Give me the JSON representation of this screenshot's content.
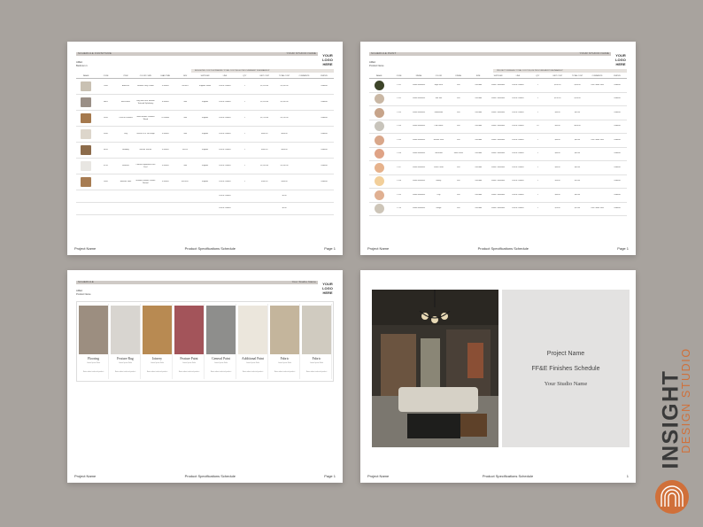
{
  "logo_text": [
    "YOUR",
    "LOGO",
    "HERE"
  ],
  "footer": {
    "project": "Project Name",
    "doc": "Product Specifications Schedule",
    "page": "Page 1",
    "page_short": "1"
  },
  "page1": {
    "header_left": "SCHEDULE   FURNITURE",
    "header_right": "YOUR STUDIO NAME",
    "area": "AREA",
    "area_name": "Bedroom 1",
    "summary": "BUDGETED COST  ESTIMATED TOTAL COST      $0.00     PROCUREMENT FEE/MARKUP",
    "columns": [
      "IMAGE",
      "CODE",
      "ITEM",
      "COLOR / SIZE",
      "LEAD TIME",
      "SKU",
      "SUPPLIER",
      "LINK",
      "QTY",
      "UNIT COST",
      "TOTAL COST",
      "COMMENTS",
      "STATUS"
    ],
    "rows": [
      [
        "",
        "CH01",
        "Armchair",
        "Weather Grey Colour",
        "4 Weeks",
        "SKU001",
        "Supplier Name",
        "Link to Product",
        "1",
        "$1,200.00",
        "$1,200.00",
        "",
        "Ordered"
      ],
      [
        "",
        "BE01",
        "Bed Frame",
        "Ivory with Rich Smooth Textured Upholstery",
        "8 Weeks",
        "N/A",
        "Supplier",
        "Link to Product",
        "1",
        "$2,200.00",
        "$2,200.00",
        "",
        "Ordered"
      ],
      [
        "",
        "DR01",
        "Chest of Drawers",
        "Solid Smooth Textured Wood",
        "10 Weeks",
        "N/A",
        "Supplier",
        "Link to Product",
        "1",
        "$1,700.00",
        "$1,700.00",
        "",
        "Ordered"
      ],
      [
        "",
        "RG01",
        "Rug",
        "Texture 90 x 180 Beige",
        "4 Weeks",
        "N/A",
        "Supplier",
        "Link to Product",
        "1",
        "$680.00",
        "$680.00",
        "",
        "Ordered"
      ],
      [
        "",
        "BD01",
        "Bedding",
        "Natural Texture",
        "4 Weeks",
        "SKU01",
        "Supplier",
        "Link to Product",
        "1",
        "$460.00",
        "$460.00",
        "",
        "Ordered"
      ],
      [
        "",
        "MT01",
        "Mattress",
        "Comfort Supportive Firm Feel",
        "4 Weeks",
        "N/A",
        "Supplier",
        "Link to Product",
        "1",
        "$1,180.00",
        "$1,180.00",
        "",
        "Ordered"
      ],
      [
        "",
        "NS01",
        "Bedside Table",
        "Wooden Smooth Texture Natural",
        "4 Weeks",
        "SKU0017",
        "Supplier",
        "Link to Product",
        "1",
        "$380.00",
        "$380.00",
        "",
        "Ordered"
      ]
    ],
    "extra_rows": [
      [
        "",
        "",
        "",
        "",
        "",
        "",
        "",
        "Link to Product",
        "",
        "",
        "$0.00",
        "",
        ""
      ],
      [
        "",
        "",
        "",
        "",
        "",
        "",
        "",
        "Link to Product",
        "",
        "",
        "$0.00",
        "",
        ""
      ]
    ],
    "thumb_colors": [
      "#c9c1b3",
      "#9a8f86",
      "#a5794d",
      "#ddd6cb",
      "#8c6b4a",
      "#e8e6e2",
      "#a77c52"
    ]
  },
  "page2": {
    "header_left": "SCHEDULE   PAINT",
    "header_right": "YOUR STUDIO NAME",
    "area": "AREA",
    "area_name": "Product Name",
    "summary": "PROJECT FINISHES TOTAL COST      $1,610      PROCUREMENT FEE/MARKUP",
    "columns": [
      "IMAGE",
      "CODE",
      "FINISH",
      "COLOR",
      "FINISH",
      "SIZE",
      "SUPPLIER",
      "LINK",
      "QTY",
      "UNIT COST",
      "TOTAL COST",
      "COMMENTS",
      "STATUS"
    ],
    "rows": [
      [
        "",
        "PT01",
        "Dulux Weathers",
        "Night Fern",
        "Flat",
        "1000MA",
        "Dulux / Weathers",
        "Link to Product",
        "1",
        "$100.00",
        "$100.00",
        "Two Colour Wall",
        "Ordered"
      ],
      [
        "",
        "PT02",
        "Dulux Weathers",
        "Sea Salt",
        "Flat",
        "1000MA",
        "Dulux / Weathers",
        "Link to Product",
        "1",
        "$150.00",
        "$150.00",
        "",
        "Ordered"
      ],
      [
        "",
        "PT03",
        "Dulux Weathers",
        "Sandstorm",
        "Flat",
        "1000MA",
        "Dulux / Weathers",
        "Link to Product",
        "1",
        "$80.00",
        "$80.00",
        "",
        "Ordered"
      ],
      [
        "",
        "PT04",
        "Dulux Weathers",
        "Cool Stone",
        "Flat",
        "1000MA",
        "Dulux / Weathers",
        "Link to Product",
        "10",
        "$85.00",
        "$850.00",
        "",
        "Ordered"
      ],
      [
        "",
        "PT05",
        "Dulux Weathers",
        "Natural Tone",
        "Flat",
        "1000MA",
        "Dulux / Weathers",
        "Link to Product",
        "1",
        "$80.00",
        "$80.00",
        "Two Colour Wall",
        "Ordered"
      ],
      [
        "",
        "PT06",
        "Dulux Weathers",
        "Terracotta",
        "Semi Gloss",
        "1000MA",
        "Dulux / Weathers",
        "Link to Product",
        "1",
        "$80.00",
        "$80.00",
        "",
        "Ordered"
      ],
      [
        "",
        "PT07",
        "Dulux Weathers",
        "Peach Glow",
        "Flat",
        "1000MA",
        "Dulux / Weathers",
        "Link to Product",
        "1",
        "$80.00",
        "$80.00",
        "",
        "Ordered"
      ],
      [
        "",
        "PT08",
        "Dulux Weathers",
        "Honey",
        "Flat",
        "1000MA",
        "Dulux / Weathers",
        "Link to Product",
        "1",
        "$90.00",
        "$90.00",
        "",
        "Ordered"
      ],
      [
        "",
        "PT09",
        "Dulux Weathers",
        "Clay",
        "Flat",
        "1000MA",
        "Dulux / Weathers",
        "Link to Product",
        "1",
        "$80.00",
        "$80.00",
        "",
        "Ordered"
      ],
      [
        "",
        "PT10",
        "Dulux Weathers",
        "Greige",
        "Flat",
        "1000MA",
        "Dulux / Weathers",
        "Link to Product",
        "1",
        "$20.00",
        "$20.00",
        "Two Colour Wall",
        "Ordered"
      ]
    ],
    "swatch_colors": [
      "#3d4429",
      "#c9b7a4",
      "#c7a48a",
      "#c8c4bb",
      "#d9a78a",
      "#dfa386",
      "#e6b28c",
      "#f2cf9a",
      "#e0b092",
      "#cdc5b8"
    ]
  },
  "page3": {
    "header_left": "SCHEDULE",
    "header_right": "Your Studio Name",
    "area": "AREA",
    "area_name": "Product Name",
    "materials": [
      {
        "name": "Flooring",
        "sub": "Lorem Ipsum Dolor",
        "sub2": "Notes about selected product",
        "color": "#9c8e80"
      },
      {
        "name": "Feature Rug",
        "sub": "Lorem Ipsum Dolor",
        "sub2": "Notes about selected product",
        "color": "#d8d5d0"
      },
      {
        "name": "Joinery",
        "sub": "Lorem Ipsum Dolor",
        "sub2": "Notes about selected product",
        "color": "#b88a52"
      },
      {
        "name": "Feature Paint",
        "sub": "Lorem Ipsum Dolor",
        "sub2": "Notes about selected product",
        "color": "#a3545a"
      },
      {
        "name": "General Paint",
        "sub": "Lorem Ipsum Dolor",
        "sub2": "Notes about selected product",
        "color": "#8e8e8c"
      },
      {
        "name": "Additional Paint",
        "sub": "Lorem Ipsum Dolor",
        "sub2": "Notes about selected product",
        "color": "#ebe6dc"
      },
      {
        "name": "Fabric",
        "sub": "Lorem Ipsum Dolor",
        "sub2": "Notes about selected product",
        "color": "#c4b59c"
      },
      {
        "name": "Fabric",
        "sub": "Lorem Ipsum Dolor",
        "sub2": "Notes about selected product",
        "color": "#d0cbc0"
      }
    ]
  },
  "page4": {
    "line1": "Project Name",
    "line2": "FF&E Finishes Schedule",
    "line3": "Your Studio Name"
  },
  "brand": {
    "main": "INSIGHT",
    "sub": "DESIGN STUDIO",
    "accent": "#d0703a"
  }
}
